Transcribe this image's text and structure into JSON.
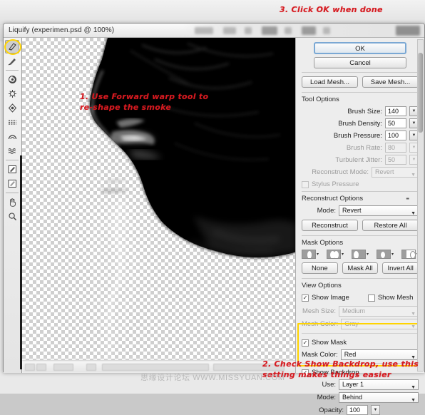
{
  "window": {
    "title": "Liquify (experimen.psd @ 100%)"
  },
  "annotations": {
    "step1": "1. Use Forward warp tool to\nre-shape the smoke",
    "step2": "2. Check Show Backdrop, use this\nsetting makes things easier",
    "step3": "3. Click OK when done",
    "watermark": "思缘设计论坛 WWW.MISSYUAN.COM"
  },
  "toolbar": {
    "tools": [
      {
        "name": "forward-warp-tool",
        "glyph": "✎",
        "selected": true
      },
      {
        "name": "reconstruct-tool",
        "glyph": "✒",
        "selected": false
      },
      {
        "name": "twirl-clockwise-tool",
        "glyph": "◔",
        "selected": false
      },
      {
        "name": "pucker-tool",
        "glyph": "⬚",
        "selected": false
      },
      {
        "name": "bloat-tool",
        "glyph": "◇",
        "selected": false
      },
      {
        "name": "push-left-tool",
        "glyph": "≈",
        "selected": false
      },
      {
        "name": "mirror-tool",
        "glyph": "◠",
        "selected": false
      },
      {
        "name": "turbulence-tool",
        "glyph": "≈",
        "selected": false
      },
      {
        "name": "freeze-mask-tool",
        "glyph": "✏",
        "selected": false
      },
      {
        "name": "thaw-mask-tool",
        "glyph": "✐",
        "selected": false
      },
      {
        "name": "hand-tool",
        "glyph": "✋",
        "selected": false
      },
      {
        "name": "zoom-tool",
        "glyph": "⌕",
        "selected": false
      }
    ]
  },
  "panel": {
    "ok_label": "OK",
    "cancel_label": "Cancel",
    "load_mesh_label": "Load Mesh...",
    "save_mesh_label": "Save Mesh...",
    "tool_options": {
      "title": "Tool Options",
      "brush_size_label": "Brush Size:",
      "brush_size_value": "140",
      "brush_density_label": "Brush Density:",
      "brush_density_value": "50",
      "brush_pressure_label": "Brush Pressure:",
      "brush_pressure_value": "100",
      "brush_rate_label": "Brush Rate:",
      "brush_rate_value": "80",
      "turbulent_jitter_label": "Turbulent Jitter:",
      "turbulent_jitter_value": "50",
      "reconstruct_mode_label": "Reconstruct Mode:",
      "reconstruct_mode_value": "Revert",
      "stylus_pressure_label": "Stylus Pressure",
      "stylus_pressure_checked": false
    },
    "reconstruct_options": {
      "title": "Reconstruct Options",
      "mode_label": "Mode:",
      "mode_value": "Revert",
      "reconstruct_label": "Reconstruct",
      "restore_all_label": "Restore All"
    },
    "mask_options": {
      "title": "Mask Options",
      "none_label": "None",
      "mask_all_label": "Mask All",
      "invert_all_label": "Invert All",
      "icons": [
        "replace-selection-icon",
        "add-to-selection-icon",
        "subtract-from-selection-icon",
        "intersect-with-selection-icon",
        "invert-selection-icon"
      ]
    },
    "view_options": {
      "title": "View Options",
      "show_image_label": "Show Image",
      "show_image_checked": true,
      "show_mesh_label": "Show Mesh",
      "show_mesh_checked": false,
      "mesh_size_label": "Mesh Size:",
      "mesh_size_value": "Medium",
      "mesh_color_label": "Mesh Color:",
      "mesh_color_value": "Gray",
      "show_mask_label": "Show Mask",
      "show_mask_checked": true,
      "mask_color_label": "Mask Color:",
      "mask_color_value": "Red",
      "show_backdrop_label": "Show Backdrop",
      "show_backdrop_checked": true,
      "use_label": "Use:",
      "use_value": "Layer 1",
      "mode_label": "Mode:",
      "mode_value": "Behind",
      "opacity_label": "Opacity:",
      "opacity_value": "100"
    }
  },
  "colors": {
    "annotation_red": "#d61a20",
    "highlight_yellow": "#ffd400",
    "panel_bg": "#ededed",
    "primary_button_border": "#7aa8d4"
  }
}
